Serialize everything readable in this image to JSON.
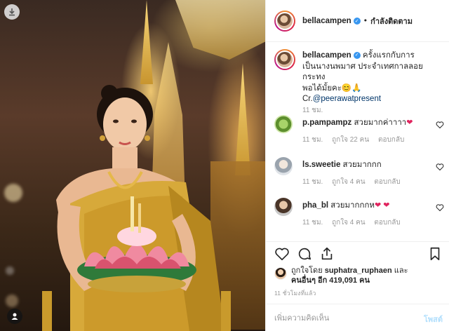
{
  "header": {
    "username": "bellacampen",
    "separator": "•",
    "follow_status": "กำลังติดตาม"
  },
  "caption": {
    "username": "bellacampen",
    "text_line1": "ครั้งแรกกับการ",
    "text_line2": "เป็นนางนพมาศ ประจำเทศกาลลอยกระทง",
    "text_line3": "พอได้มั้ยคะ😊🙏",
    "credit_prefix": "Cr.",
    "credit_mention": "@peerawatpresent",
    "time": "11 ชม."
  },
  "comments": [
    {
      "username": "p.pampampz",
      "text": "สวยมากค่าาาา",
      "emoji": "❤",
      "time": "11 ชม.",
      "likes": "ถูกใจ 22 คน",
      "reply": "ตอบกลับ"
    },
    {
      "username": "ls.sweetie",
      "text": "สวยมากกก",
      "emoji": "",
      "time": "11 ชม.",
      "likes": "ถูกใจ 4 คน",
      "reply": "ตอบกลับ"
    },
    {
      "username": "pha_bl",
      "text": "สวยมากกกห",
      "emoji": "❤ ❤",
      "time": "11 ชม.",
      "likes": "ถูกใจ 4 คน",
      "reply": "ตอบกลับ"
    }
  ],
  "likes": {
    "prefix": "ถูกใจโดย",
    "liker": "suphatra_ruphaen",
    "and": "และ",
    "others": "คนอื่นๆ อีก 419,091 คน"
  },
  "post_time": "11 ชั่วโมงที่แล้ว",
  "add_comment": {
    "placeholder": "เพิ่มความคิดเห็น",
    "post_label": "โพสต์"
  },
  "icons": {
    "like": "heart-icon",
    "comment": "comment-icon",
    "share": "share-icon",
    "save": "bookmark-icon",
    "download": "download-icon",
    "tag": "person-tag-icon"
  },
  "colors": {
    "verified": "#3897f0",
    "text": "#262626",
    "secondary": "#999999",
    "mention": "#003569",
    "post_button": "#b2dffc",
    "heart": "#e0245e"
  }
}
